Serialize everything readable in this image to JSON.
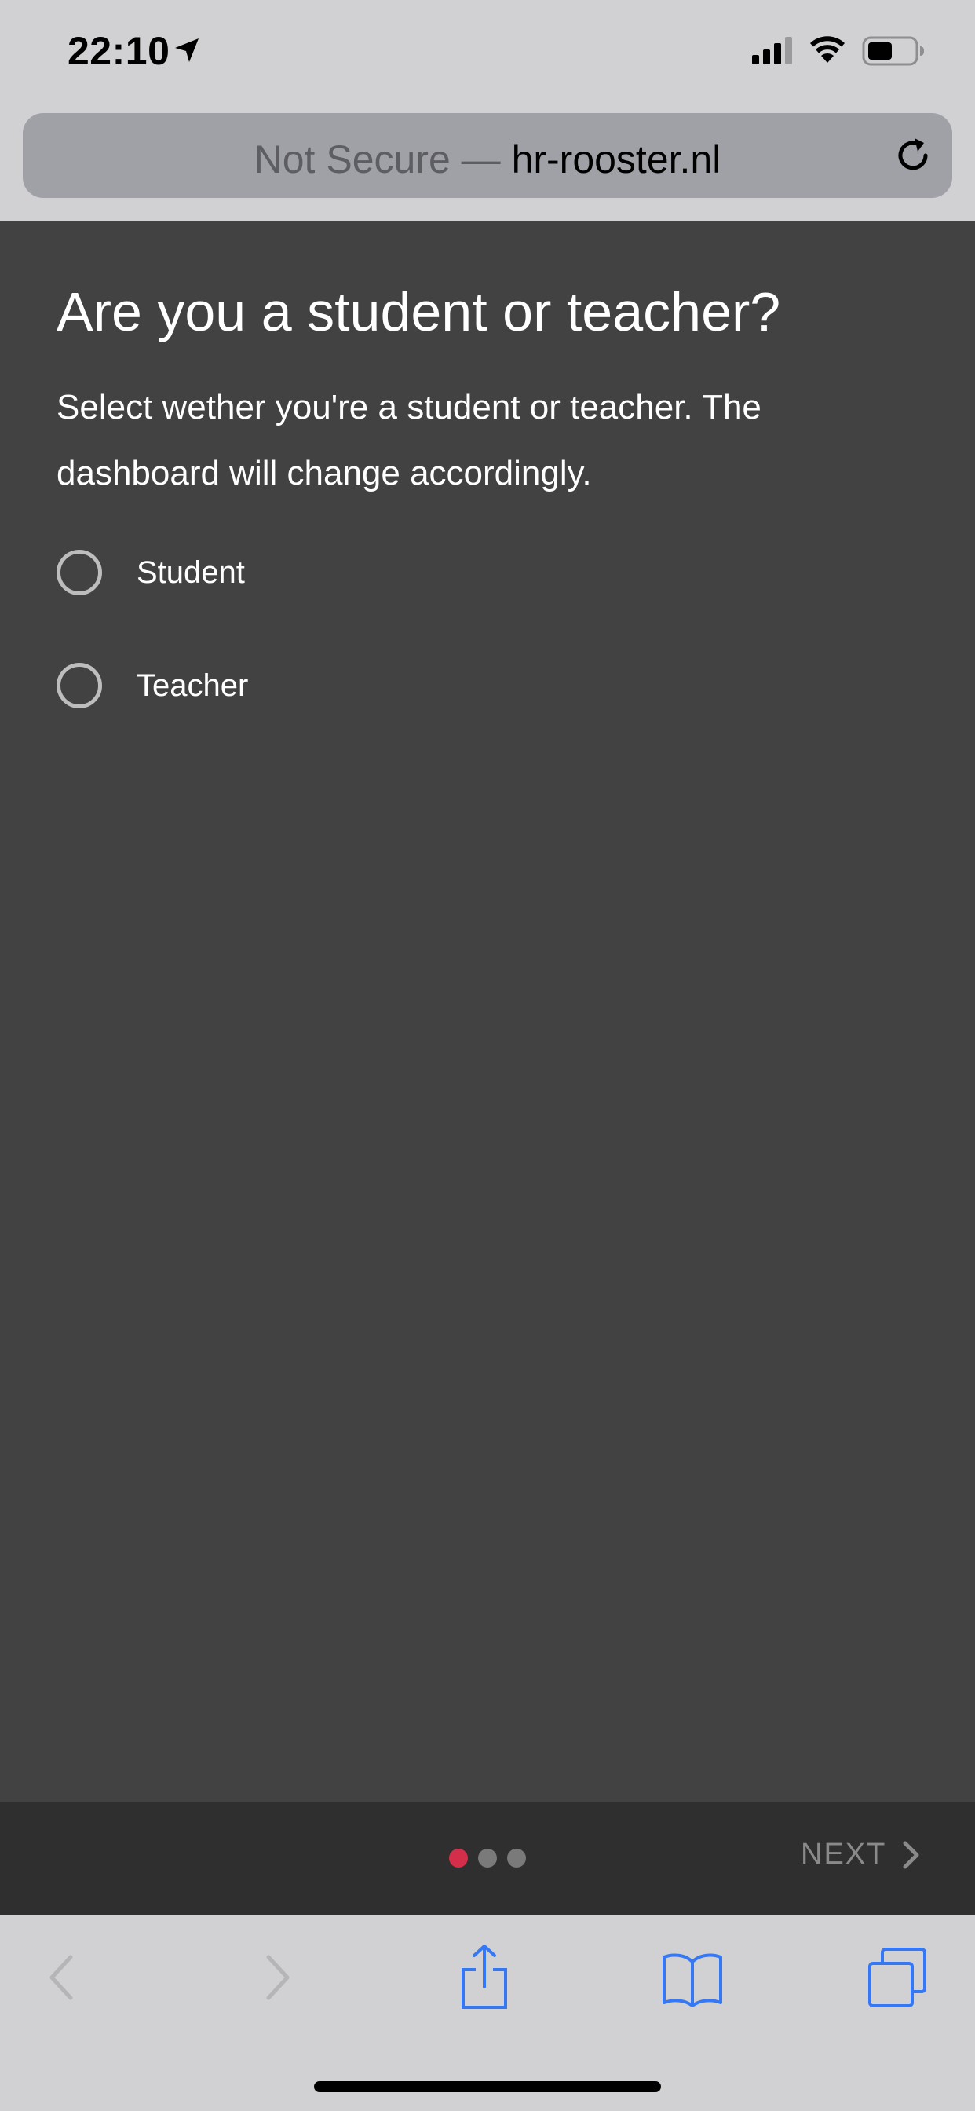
{
  "status_bar": {
    "time": "22:10"
  },
  "url_bar": {
    "security": "Not Secure —",
    "domain": "hr-rooster.nl"
  },
  "page": {
    "title": "Are you a student or teacher?",
    "subtitle": "Select wether you're a student or teacher. The dashboard will change accordingly.",
    "options": [
      {
        "label": "Student",
        "selected": false
      },
      {
        "label": "Teacher",
        "selected": false
      }
    ]
  },
  "stepper": {
    "current_step": 1,
    "total_steps": 3,
    "next_label": "NEXT",
    "active_color": "#d32f4a"
  },
  "toolbar": {
    "icons": [
      "back-icon",
      "forward-icon",
      "share-icon",
      "bookmarks-icon",
      "tabs-icon"
    ]
  }
}
